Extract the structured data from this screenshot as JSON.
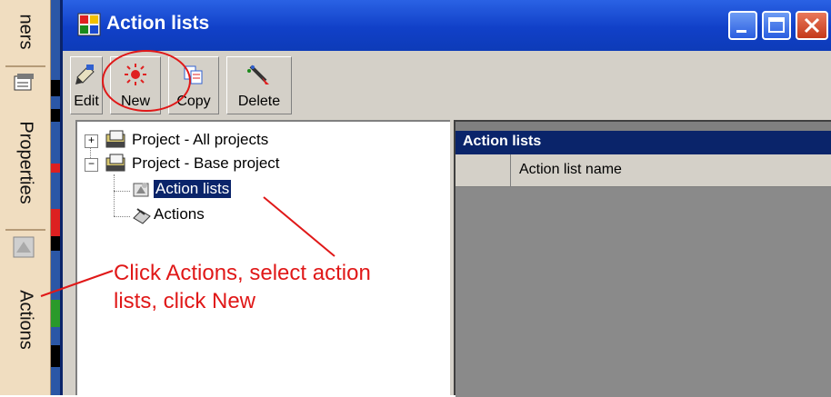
{
  "sidebar": {
    "tabs": [
      {
        "label": "ners"
      },
      {
        "label": "Properties"
      },
      {
        "label": "Actions"
      }
    ]
  },
  "window": {
    "title": "Action lists",
    "controls": {
      "minimize": "minimize",
      "maximize": "maximize",
      "close": "close"
    }
  },
  "toolbar": {
    "edit_label": "Edit",
    "new_label": "New",
    "copy_label": "Copy",
    "delete_label": "Delete"
  },
  "tree": {
    "items": [
      {
        "label": "Project - All projects",
        "expander": "+"
      },
      {
        "label": "Project - Base project",
        "expander": "−"
      },
      {
        "label": "Action lists"
      },
      {
        "label": "Actions"
      }
    ]
  },
  "list": {
    "title": "Action lists",
    "column": "Action list name"
  },
  "annotation": {
    "line1": "Click Actions, select action",
    "line2": "lists, click New"
  },
  "colors": {
    "titlebar": "#1140c8",
    "selection": "#0a246a",
    "annotation": "#e01818",
    "sidebar": "#f0ddc0"
  }
}
